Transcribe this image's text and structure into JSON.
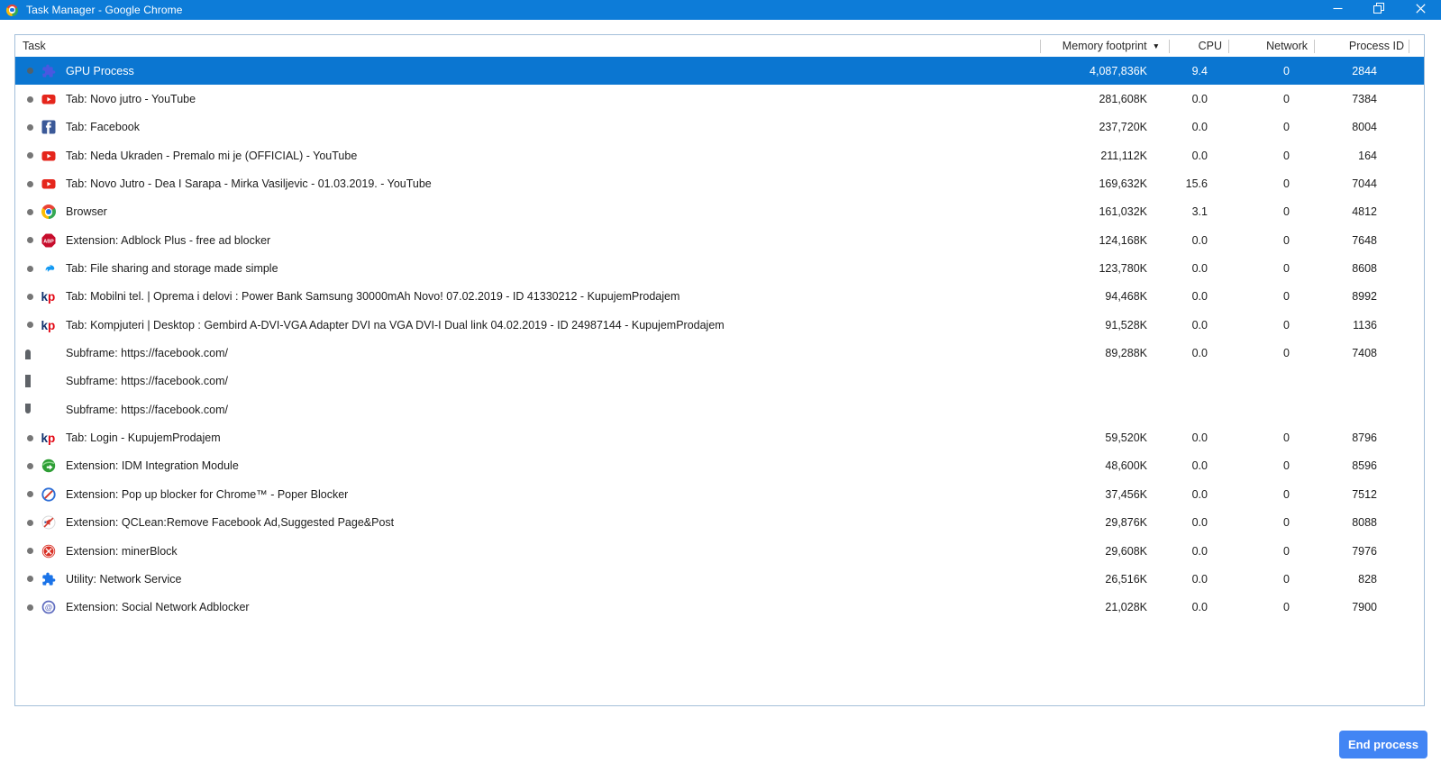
{
  "titlebar": {
    "title": "Task Manager - Google Chrome",
    "app_icon": "chrome-logo-icon",
    "controls": {
      "minimize": "minimize",
      "restore": "restore",
      "close": "close"
    }
  },
  "colors": {
    "titlebar_blue": "#0d7cd8",
    "selection_blue": "#0b76d1",
    "button_blue": "#4285f4",
    "table_border": "#a3bfd9",
    "group_bar_gray": "#5f6368"
  },
  "table": {
    "columns": [
      {
        "id": "task",
        "label": "Task"
      },
      {
        "id": "memory",
        "label": "Memory footprint",
        "sort_indicator": "▼",
        "sorted": "desc"
      },
      {
        "id": "cpu",
        "label": "CPU"
      },
      {
        "id": "network",
        "label": "Network"
      },
      {
        "id": "pid",
        "label": "Process ID"
      }
    ],
    "rows": [
      {
        "icon": "gpu-puzzle-icon",
        "task": "GPU Process",
        "memory": "4,087,836K",
        "cpu": "9.4",
        "network": "0",
        "process_id": "2844",
        "selected": true
      },
      {
        "icon": "youtube-icon",
        "task": "Tab: Novo jutro - YouTube",
        "memory": "281,608K",
        "cpu": "0.0",
        "network": "0",
        "process_id": "7384"
      },
      {
        "icon": "facebook-icon",
        "task": "Tab: Facebook",
        "memory": "237,720K",
        "cpu": "0.0",
        "network": "0",
        "process_id": "8004"
      },
      {
        "icon": "youtube-icon",
        "task": "Tab: Neda Ukraden - Premalo mi je (OFFICIAL) - YouTube",
        "memory": "211,112K",
        "cpu": "0.0",
        "network": "0",
        "process_id": "164"
      },
      {
        "icon": "youtube-icon",
        "task": "Tab: Novo Jutro - Dea I Sarapa - Mirka Vasiljevic - 01.03.2019. - YouTube",
        "memory": "169,632K",
        "cpu": "15.6",
        "network": "0",
        "process_id": "7044"
      },
      {
        "icon": "chrome-browser-icon",
        "task": "Browser",
        "memory": "161,032K",
        "cpu": "3.1",
        "network": "0",
        "process_id": "4812"
      },
      {
        "icon": "adblock-plus-icon",
        "task": "Extension: Adblock Plus - free ad blocker",
        "memory": "124,168K",
        "cpu": "0.0",
        "network": "0",
        "process_id": "7648"
      },
      {
        "icon": "mediafire-icon",
        "task": "Tab: File sharing and storage made simple",
        "memory": "123,780K",
        "cpu": "0.0",
        "network": "0",
        "process_id": "8608"
      },
      {
        "icon": "kupujemprodajem-icon",
        "task": "Tab: Mobilni tel. | Oprema i delovi : Power Bank Samsung 30000mAh Novo! 07.02.2019 - ID 41330212 - KupujemProdajem",
        "memory": "94,468K",
        "cpu": "0.0",
        "network": "0",
        "process_id": "8992"
      },
      {
        "icon": "kupujemprodajem-icon",
        "task": "Tab: Kompjuteri | Desktop : Gembird A-DVI-VGA Adapter DVI na VGA DVI-I Dual link 04.02.2019 - ID 24987144 - KupujemProdajem",
        "memory": "91,528K",
        "cpu": "0.0",
        "network": "0",
        "process_id": "1136"
      },
      {
        "icon": null,
        "group": "start",
        "task": "Subframe: https://facebook.com/",
        "memory": "89,288K",
        "cpu": "0.0",
        "network": "0",
        "process_id": "7408"
      },
      {
        "icon": null,
        "group": "mid",
        "task": "Subframe: https://facebook.com/",
        "memory": "",
        "cpu": "",
        "network": "",
        "process_id": ""
      },
      {
        "icon": null,
        "group": "end",
        "task": "Subframe: https://facebook.com/",
        "memory": "",
        "cpu": "",
        "network": "",
        "process_id": ""
      },
      {
        "icon": "kupujemprodajem-icon",
        "task": "Tab: Login - KupujemProdajem",
        "memory": "59,520K",
        "cpu": "0.0",
        "network": "0",
        "process_id": "8796"
      },
      {
        "icon": "idm-icon",
        "task": "Extension: IDM Integration Module",
        "memory": "48,600K",
        "cpu": "0.0",
        "network": "0",
        "process_id": "8596"
      },
      {
        "icon": "poper-blocker-icon",
        "task": "Extension: Pop up blocker for Chrome™ - Poper Blocker",
        "memory": "37,456K",
        "cpu": "0.0",
        "network": "0",
        "process_id": "7512"
      },
      {
        "icon": "qclean-icon",
        "task": "Extension: QCLean:Remove Facebook Ad,Suggested Page&Post",
        "memory": "29,876K",
        "cpu": "0.0",
        "network": "0",
        "process_id": "8088"
      },
      {
        "icon": "minerblock-icon",
        "task": "Extension: minerBlock",
        "memory": "29,608K",
        "cpu": "0.0",
        "network": "0",
        "process_id": "7976"
      },
      {
        "icon": "puzzle-piece-icon",
        "task": "Utility: Network Service",
        "memory": "26,516K",
        "cpu": "0.0",
        "network": "0",
        "process_id": "828"
      },
      {
        "icon": "social-network-adblocker-icon",
        "task": "Extension: Social Network Adblocker",
        "memory": "21,028K",
        "cpu": "0.0",
        "network": "0",
        "process_id": "7900"
      }
    ]
  },
  "footer": {
    "end_process_label": "End process"
  }
}
